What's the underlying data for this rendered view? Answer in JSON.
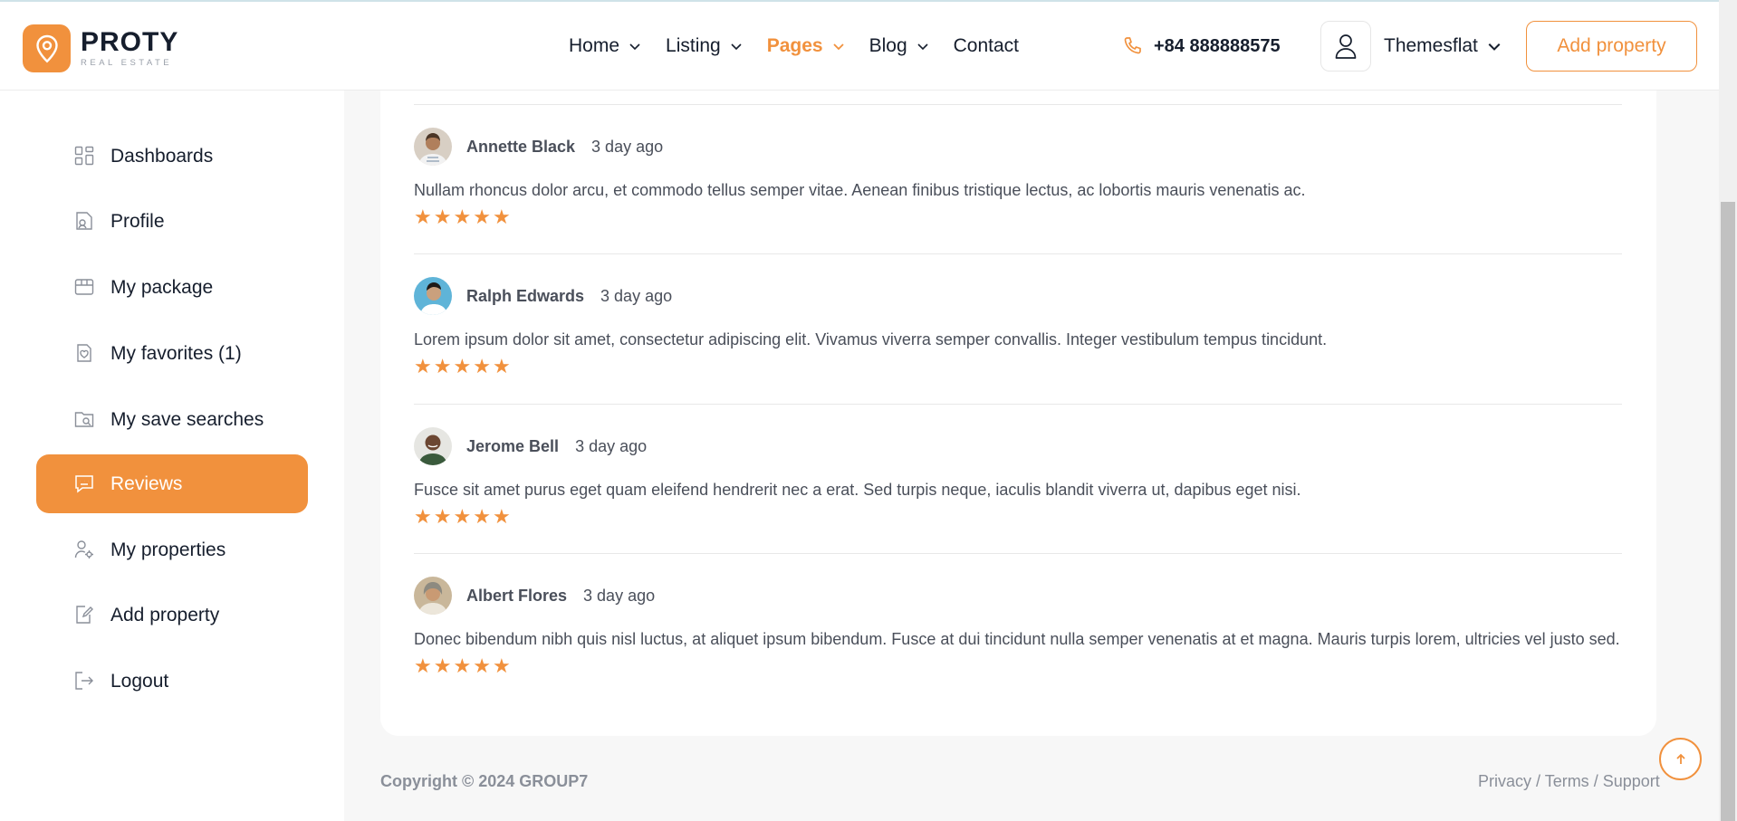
{
  "brand": {
    "name": "PROTY",
    "tagline": "REAL ESTATE",
    "accent": "#f1913d"
  },
  "nav": {
    "items": [
      {
        "label": "Home",
        "has_dropdown": true,
        "active": false
      },
      {
        "label": "Listing",
        "has_dropdown": true,
        "active": false
      },
      {
        "label": "Pages",
        "has_dropdown": true,
        "active": true
      },
      {
        "label": "Blog",
        "has_dropdown": true,
        "active": false
      },
      {
        "label": "Contact",
        "has_dropdown": false,
        "active": false
      }
    ],
    "phone": "+84 888888575",
    "user_name": "Themesflat",
    "add_property_label": "Add property"
  },
  "sidebar": {
    "items": [
      {
        "label": "Dashboards",
        "icon": "dashboard-icon",
        "active": false
      },
      {
        "label": "Profile",
        "icon": "profile-icon",
        "active": false
      },
      {
        "label": "My package",
        "icon": "package-icon",
        "active": false
      },
      {
        "label": "My favorites (1)",
        "icon": "favorites-icon",
        "active": false
      },
      {
        "label": "My save searches",
        "icon": "saved-search-icon",
        "active": false
      },
      {
        "label": "Reviews",
        "icon": "reviews-icon",
        "active": true
      },
      {
        "label": "My properties",
        "icon": "properties-icon",
        "active": false
      },
      {
        "label": "Add property",
        "icon": "add-property-icon",
        "active": false
      },
      {
        "label": "Logout",
        "icon": "logout-icon",
        "active": false
      }
    ]
  },
  "reviews": [
    {
      "name": "Annette Black",
      "time": "3 day ago",
      "text": "Nullam rhoncus dolor arcu, et commodo tellus semper vitae. Aenean finibus tristique lectus, ac lobortis mauris venenatis ac.",
      "rating": 5
    },
    {
      "name": "Ralph Edwards",
      "time": "3 day ago",
      "text": "Lorem ipsum dolor sit amet, consectetur adipiscing elit. Vivamus viverra semper convallis. Integer vestibulum tempus tincidunt.",
      "rating": 5
    },
    {
      "name": "Jerome Bell",
      "time": "3 day ago",
      "text": "Fusce sit amet purus eget quam eleifend hendrerit nec a erat. Sed turpis neque, iaculis blandit viverra ut, dapibus eget nisi.",
      "rating": 5
    },
    {
      "name": "Albert Flores",
      "time": "3 day ago",
      "text": "Donec bibendum nibh quis nisl luctus, at aliquet ipsum bibendum. Fusce at dui tincidunt nulla semper venenatis at et magna. Mauris turpis lorem, ultricies vel justo sed.",
      "rating": 5
    }
  ],
  "footer": {
    "copyright": "Copyright © 2024 GROUP7",
    "links": "Privacy / Terms / Support"
  }
}
